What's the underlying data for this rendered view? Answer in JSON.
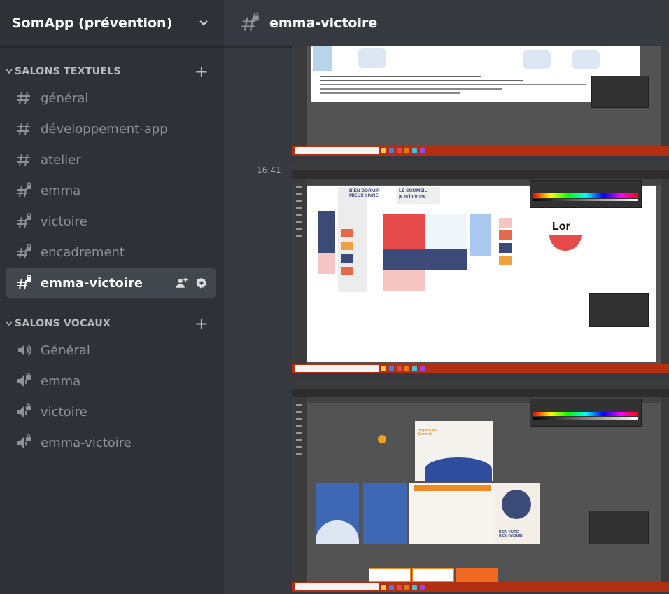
{
  "server": {
    "name": "SomApp (prévention)",
    "menu_icon": "chevron-down-icon"
  },
  "text_category": {
    "label": "SALONS TEXTUELS",
    "add_icon": "plus-icon"
  },
  "text_channels": [
    {
      "label": "général",
      "icon": "hashtag-icon"
    },
    {
      "label": "développement-app",
      "icon": "hashtag-icon"
    },
    {
      "label": "atelier",
      "icon": "hashtag-icon"
    },
    {
      "label": "emma",
      "icon": "locked-hashtag-icon"
    },
    {
      "label": "victoire",
      "icon": "locked-hashtag-icon"
    },
    {
      "label": "encadrement",
      "icon": "locked-hashtag-icon"
    },
    {
      "label": "emma-victoire",
      "icon": "locked-hashtag-icon",
      "selected": true
    }
  ],
  "voice_category": {
    "label": "SALONS VOCAUX",
    "add_icon": "plus-icon"
  },
  "voice_channels": [
    {
      "label": "Général",
      "icon": "speaker-icon"
    },
    {
      "label": "emma",
      "icon": "locked-speaker-icon"
    },
    {
      "label": "victoire",
      "icon": "locked-speaker-icon"
    },
    {
      "label": "emma-victoire",
      "icon": "locked-speaker-icon"
    }
  ],
  "channel_header": {
    "title": "emma-victoire",
    "icon": "locked-hashtag-icon"
  },
  "messages": [
    {
      "timestamp": "16:41"
    }
  ],
  "screenshots": [
    {
      "name": "illustrator-screenshot-1"
    },
    {
      "name": "illustrator-screenshot-2",
      "lines": [
        "BIEN DORMIR",
        "MIEUX VIVRE",
        "LE SOMMEIL",
        "je m'informe !",
        "Lor"
      ]
    },
    {
      "name": "illustrator-screenshot-3",
      "lines": [
        "Hygiène du Sommeil",
        "BIEN VIVRE",
        "BIEN DORMIR"
      ]
    }
  ],
  "colors": {
    "sidebar_bg": "#2f3136",
    "main_bg": "#36393f",
    "selected_bg": "#42464d",
    "text_muted": "#8e9297",
    "text_white": "#ffffff"
  }
}
